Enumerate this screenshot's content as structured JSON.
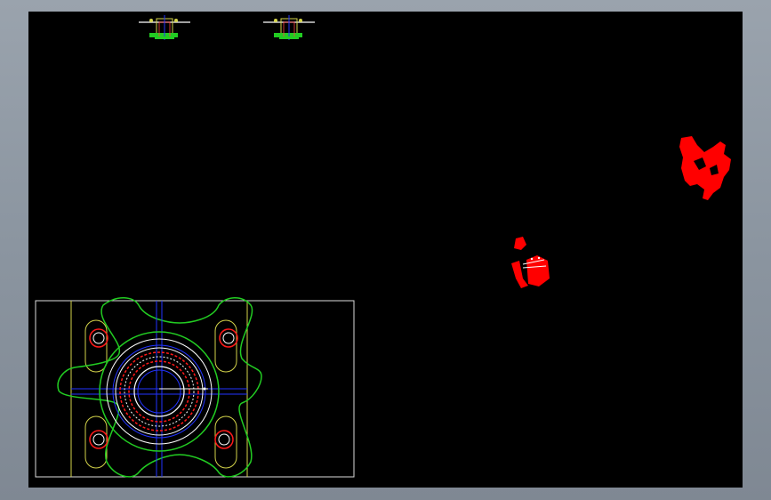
{
  "window": {
    "frame_color": "#8c96a1",
    "canvas_background": "#000000"
  },
  "drawing": {
    "colors": {
      "outline_green": "#22cc22",
      "circle_white": "#ffffff",
      "centerline_blue": "#2233ff",
      "hole_red": "#ff1a1a",
      "frame_yellow": "#d4d44a",
      "frame_white": "#dddddd",
      "highlight_red": "#ff0000"
    },
    "views": [
      {
        "name": "top-section-view-left"
      },
      {
        "name": "top-section-view-right"
      },
      {
        "name": "plan-view-flange"
      },
      {
        "name": "selection-highlight-small"
      },
      {
        "name": "selection-highlight-large"
      }
    ]
  }
}
